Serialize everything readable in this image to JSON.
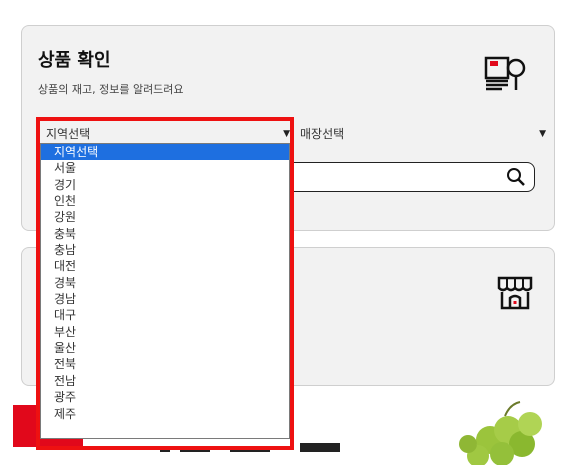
{
  "card_product": {
    "title": "상품 확인",
    "subtitle": "상품의 재고, 정보를 알려드려요",
    "icon": "document-search-icon",
    "region_select": {
      "value": "지역선택"
    },
    "store_select": {
      "value": "매장선택"
    },
    "search": {
      "value": "",
      "icon": "search-icon"
    }
  },
  "card_store": {
    "icon": "storefront-icon"
  },
  "region_dropdown": {
    "selected": "지역선택",
    "options": [
      "지역선택",
      "서울",
      "경기",
      "인천",
      "강원",
      "충북",
      "충남",
      "대전",
      "경북",
      "경남",
      "대구",
      "부산",
      "울산",
      "전북",
      "전남",
      "광주",
      "제주"
    ]
  },
  "colors": {
    "highlight": "#ee1111",
    "selected_option": "#1e6fe0",
    "brand_red": "#e1081b"
  }
}
